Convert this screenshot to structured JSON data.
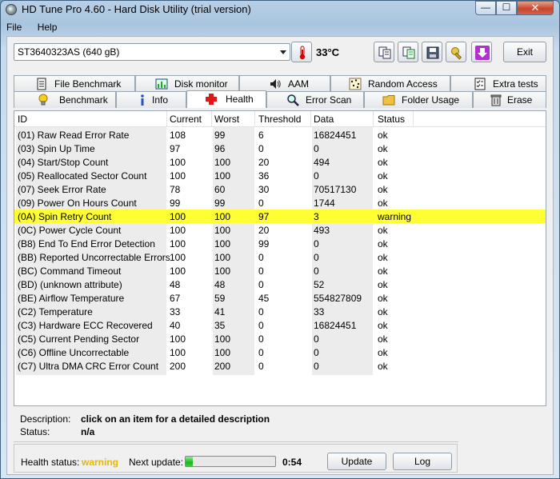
{
  "window": {
    "title": "HD Tune Pro 4.60 - Hard Disk Utility (trial version)"
  },
  "window_controls": {
    "minimize": "—",
    "maximize": "☐",
    "close": "✕"
  },
  "menu": [
    "File",
    "Help"
  ],
  "toolbar": {
    "drive": "ST3640323AS (640 gB)",
    "temperature": "33°C",
    "exit_label": "Exit"
  },
  "tabs_top": [
    "File Benchmark",
    "Disk monitor",
    "AAM",
    "Random Access",
    "Extra tests"
  ],
  "tabs_bottom": [
    "Benchmark",
    "Info",
    "Health",
    "Error Scan",
    "Folder Usage",
    "Erase"
  ],
  "active_tab": "Health",
  "table": {
    "columns": [
      "ID",
      "Current",
      "Worst",
      "Threshold",
      "Data",
      "Status"
    ],
    "rows": [
      [
        "(01) Raw Read Error Rate",
        "108",
        "99",
        "6",
        "16824451",
        "ok"
      ],
      [
        "(03) Spin Up Time",
        "97",
        "96",
        "0",
        "0",
        "ok"
      ],
      [
        "(04) Start/Stop Count",
        "100",
        "100",
        "20",
        "494",
        "ok"
      ],
      [
        "(05) Reallocated Sector Count",
        "100",
        "100",
        "36",
        "0",
        "ok"
      ],
      [
        "(07) Seek Error Rate",
        "78",
        "60",
        "30",
        "70517130",
        "ok"
      ],
      [
        "(09) Power On Hours Count",
        "99",
        "99",
        "0",
        "1744",
        "ok"
      ],
      [
        "(0A) Spin Retry Count",
        "100",
        "100",
        "97",
        "3",
        "warning"
      ],
      [
        "(0C) Power Cycle Count",
        "100",
        "100",
        "20",
        "493",
        "ok"
      ],
      [
        "(B8) End To End Error Detection",
        "100",
        "100",
        "99",
        "0",
        "ok"
      ],
      [
        "(BB) Reported Uncorrectable Errors",
        "100",
        "100",
        "0",
        "0",
        "ok"
      ],
      [
        "(BC) Command Timeout",
        "100",
        "100",
        "0",
        "0",
        "ok"
      ],
      [
        "(BD) (unknown attribute)",
        "48",
        "48",
        "0",
        "52",
        "ok"
      ],
      [
        "(BE) Airflow Temperature",
        "67",
        "59",
        "45",
        "554827809",
        "ok"
      ],
      [
        "(C2) Temperature",
        "33",
        "41",
        "0",
        "33",
        "ok"
      ],
      [
        "(C3) Hardware ECC Recovered",
        "40",
        "35",
        "0",
        "16824451",
        "ok"
      ],
      [
        "(C5) Current Pending Sector",
        "100",
        "100",
        "0",
        "0",
        "ok"
      ],
      [
        "(C6) Offline Uncorrectable",
        "100",
        "100",
        "0",
        "0",
        "ok"
      ],
      [
        "(C7) Ultra DMA CRC Error Count",
        "200",
        "200",
        "0",
        "0",
        "ok"
      ]
    ],
    "warning_row_color": "#ffff33"
  },
  "description": {
    "label": "Description:",
    "value": "click on an item for a detailed description",
    "status_label": "Status:",
    "status_value": "n/a"
  },
  "health": {
    "status_label": "Health status:",
    "status_value": "warning",
    "next_update_label": "Next update:",
    "progress": 0.08,
    "countdown": "0:54",
    "update_label": "Update",
    "log_label": "Log"
  }
}
